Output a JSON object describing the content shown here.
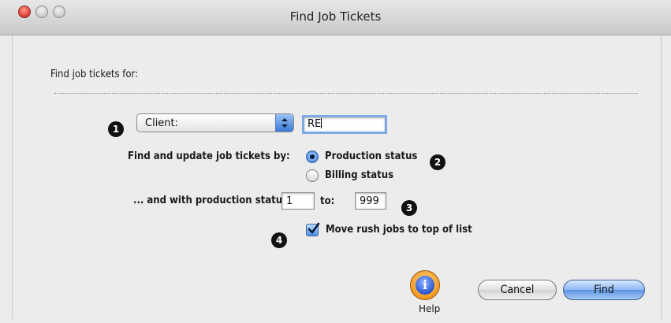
{
  "window": {
    "title": "Find Job Tickets"
  },
  "form": {
    "section_label": "Find job tickets for:",
    "field_type_popup": {
      "selected": "Client:"
    },
    "search_value": "RE",
    "find_by_label": "Find and update job tickets by:",
    "find_by_options": [
      {
        "label": "Production status",
        "selected": true
      },
      {
        "label": "Billing status",
        "selected": false
      }
    ],
    "production_status_label": "... and with production status:",
    "production_status_from": "1",
    "to_label": "to:",
    "production_status_to": "999",
    "rush_checkbox": {
      "label": "Move rush jobs to top of list",
      "checked": true
    }
  },
  "callouts": [
    "1",
    "2",
    "3",
    "4"
  ],
  "buttons": {
    "help_label": "Help",
    "help_icon_glyph": "i",
    "cancel": "Cancel",
    "find": "Find"
  },
  "colors": {
    "accent_blue": "#4d8ee8",
    "close_red": "#e0463a",
    "help_orange": "#f39a1c"
  }
}
